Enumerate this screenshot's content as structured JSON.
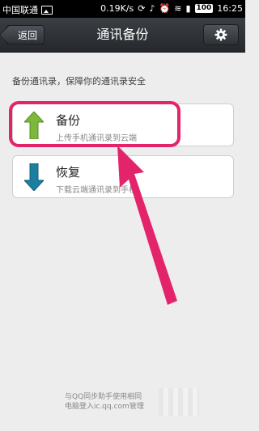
{
  "status_bar": {
    "carrier": "中国联通",
    "speed": "0.19K/s",
    "battery": "100",
    "time": "16:25"
  },
  "nav": {
    "back_label": "返回",
    "title": "通讯备份",
    "settings_icon": "gear-icon"
  },
  "description": "备份通讯录，保障你的通讯录安全",
  "actions": [
    {
      "title": "备份",
      "subtitle": "上传手机通讯录到云端",
      "icon": "arrow-up-icon",
      "color": "#7cb83c"
    },
    {
      "title": "恢复",
      "subtitle": "下载云端通讯录到手机",
      "icon": "arrow-down-icon",
      "color": "#1c7fa0"
    }
  ],
  "footer": {
    "line1": "与QQ同步助手使用相同",
    "line2": "电脑登入ic.qq.com管理"
  },
  "annotation_color": "#e3246a"
}
